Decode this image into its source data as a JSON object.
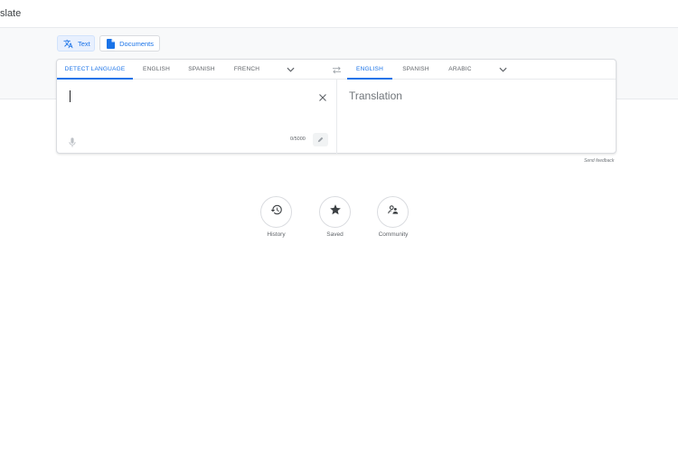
{
  "app": {
    "title": "slate"
  },
  "modes": {
    "text_label": "Text",
    "documents_label": "Documents"
  },
  "source_languages": [
    "DETECT LANGUAGE",
    "ENGLISH",
    "SPANISH",
    "FRENCH"
  ],
  "target_languages": [
    "ENGLISH",
    "SPANISH",
    "ARABIC"
  ],
  "input": {
    "char_count": "0/5000"
  },
  "output": {
    "placeholder": "Translation"
  },
  "feedback_label": "Send feedback",
  "shortcuts": [
    {
      "label": "History",
      "icon": "history-icon"
    },
    {
      "label": "Saved",
      "icon": "star-icon"
    },
    {
      "label": "Community",
      "icon": "community-icon"
    }
  ],
  "colors": {
    "accent": "#1a73e8",
    "muted": "#5f6368",
    "border": "#dadce0"
  }
}
